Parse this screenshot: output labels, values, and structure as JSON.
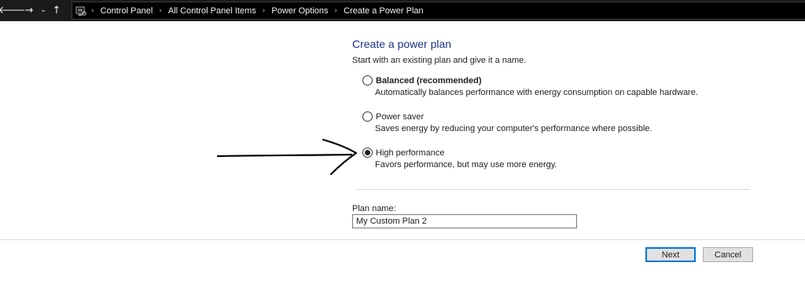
{
  "navigation": {
    "back_icon": "back-arrow-icon",
    "back_glyph": "🡐",
    "forward_icon": "forward-arrow-icon",
    "forward_glyph": "→",
    "recent_icon": "chevron-down-icon",
    "recent_glyph": "⌄",
    "up_icon": "up-arrow-icon",
    "up_glyph": "↑"
  },
  "address_bar": {
    "location_icon": "control-panel-icon",
    "separator_glyph": "›",
    "breadcrumbs": [
      "Control Panel",
      "All Control Panel Items",
      "Power Options",
      "Create a Power Plan"
    ]
  },
  "content": {
    "title": "Create a power plan",
    "intro": "Start with an existing plan and give it a name.",
    "options": [
      {
        "label": "Balanced (recommended)",
        "description": "Automatically balances performance with energy consumption on capable hardware.",
        "selected": false
      },
      {
        "label": "Power saver",
        "description": "Saves energy by reducing your computer's performance where possible.",
        "selected": false
      },
      {
        "label": "High performance",
        "description": "Favors performance, but may use more energy.",
        "selected": true
      }
    ],
    "plan_name_label": "Plan name:",
    "plan_name_value": "My Custom Plan 2"
  },
  "buttons": {
    "next": "Next",
    "cancel": "Cancel"
  },
  "colors": {
    "title": "#1e3287",
    "address_bar_bg": "#1b1b1b",
    "default_button_border": "#0078d7",
    "annotation_ink": "#000000"
  },
  "annotation": {
    "type": "hand-drawn-arrow",
    "points_to": "High performance"
  }
}
